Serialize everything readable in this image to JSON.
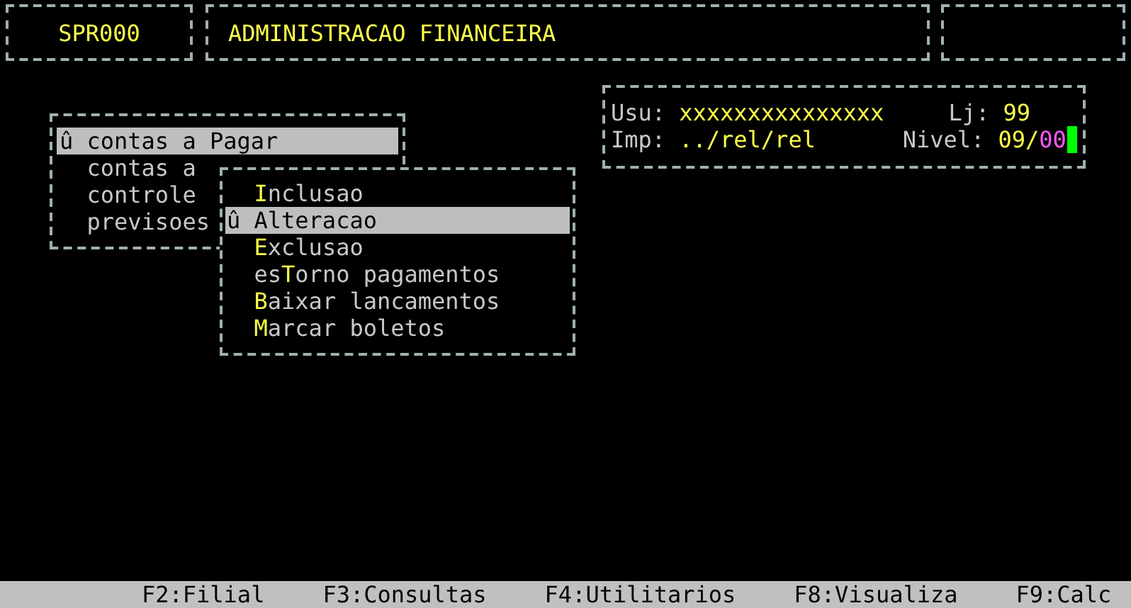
{
  "header": {
    "code": "SPR000",
    "title": "ADMINISTRACAO FINANCEIRA"
  },
  "main_menu": {
    "items": [
      {
        "label": "contas a Pagar",
        "marker": "û",
        "selected": true
      },
      {
        "label": "contas a",
        "selected": false
      },
      {
        "label": "controle",
        "selected": false
      },
      {
        "label": "previsoes",
        "selected": false
      }
    ]
  },
  "submenu": {
    "items": [
      {
        "label": "**I**nclusao",
        "selected": false
      },
      {
        "label": "Alteracao",
        "marker": "û",
        "selected": true
      },
      {
        "label": "**E**xclusao",
        "selected": false
      },
      {
        "label": "es**T**orno pagamentos",
        "selected": false
      },
      {
        "label": "**B**aixar lancamentos",
        "selected": false
      },
      {
        "label": "**M**arcar boletos",
        "selected": false
      }
    ]
  },
  "info": {
    "user_label": "Usu:",
    "user": "xxxxxxxxxxxxxxx",
    "store_label": "Lj:",
    "store": "99",
    "printer_label": "Imp:",
    "printer": "../rel/rel",
    "level_label": "Nivel:",
    "level": "09/*00*"
  },
  "status_bar": [
    "F2:Filial",
    "F3:Consultas",
    "F4:Utilitarios",
    "F8:Visualiza",
    "F9:Calc"
  ]
}
